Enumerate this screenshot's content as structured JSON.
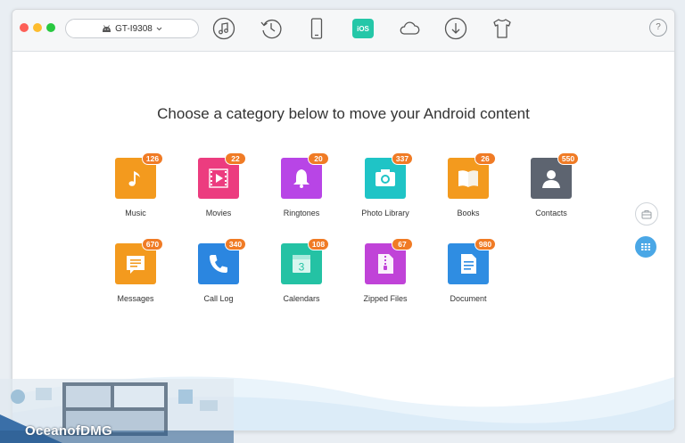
{
  "toolbar": {
    "device_name": "GT-I9308",
    "ios_label": "iOS",
    "help_label": "?"
  },
  "main": {
    "heading": "Choose a category below to move your Android content"
  },
  "categories": [
    {
      "label": "Music",
      "count": "126",
      "color": "#f39a1e",
      "icon": "music-note-icon"
    },
    {
      "label": "Movies",
      "count": "22",
      "color": "#ec3c7f",
      "icon": "film-icon"
    },
    {
      "label": "Ringtones",
      "count": "20",
      "color": "#b845e6",
      "icon": "bell-icon"
    },
    {
      "label": "Photo Library",
      "count": "337",
      "color": "#1fc4c6",
      "icon": "camera-icon"
    },
    {
      "label": "Books",
      "count": "26",
      "color": "#f39a1e",
      "icon": "book-icon"
    },
    {
      "label": "Contacts",
      "count": "550",
      "color": "#5d6470",
      "icon": "person-icon"
    },
    {
      "label": "Messages",
      "count": "670",
      "color": "#f39a1e",
      "icon": "message-icon"
    },
    {
      "label": "Call Log",
      "count": "340",
      "color": "#2b86e0",
      "icon": "phone-icon"
    },
    {
      "label": "Calendars",
      "count": "108",
      "color": "#24c2a4",
      "icon": "calendar-icon"
    },
    {
      "label": "Zipped Files",
      "count": "67",
      "color": "#c043d8",
      "icon": "zip-icon"
    },
    {
      "label": "Document",
      "count": "980",
      "color": "#2f8de2",
      "icon": "document-icon"
    }
  ],
  "calendar_day": "3",
  "watermark": "OceanofDMG"
}
